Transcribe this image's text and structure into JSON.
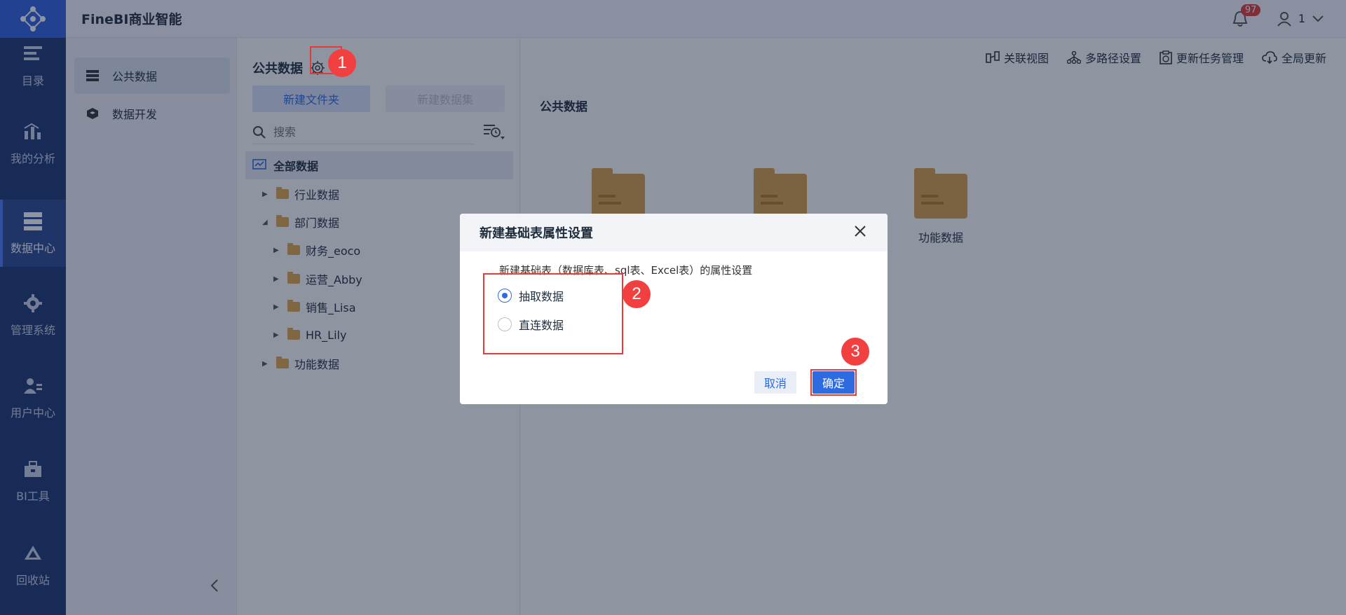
{
  "app": {
    "title": "FineBI商业智能"
  },
  "rail": {
    "items": [
      {
        "label": "目录",
        "icon": "catalog-icon"
      },
      {
        "label": "我的分析",
        "icon": "chart-icon"
      },
      {
        "label": "数据中心",
        "icon": "database-icon",
        "active": true
      },
      {
        "label": "管理系统",
        "icon": "gear-icon"
      },
      {
        "label": "用户中心",
        "icon": "user-icon"
      },
      {
        "label": "BI工具",
        "icon": "toolbox-icon"
      },
      {
        "label": "回收站",
        "icon": "recycle-icon"
      }
    ]
  },
  "topbar": {
    "notif_count": "97",
    "user": "1"
  },
  "nav2": {
    "items": [
      {
        "label": "公共数据",
        "active": true
      },
      {
        "label": "数据开发"
      }
    ]
  },
  "tree": {
    "title": "公共数据",
    "new_folder": "新建文件夹",
    "new_dataset": "新建数据集",
    "search_placeholder": "搜索",
    "root": "全部数据",
    "nodes": [
      {
        "label": "行业数据"
      },
      {
        "label": "部门数据"
      },
      {
        "label": "财务_eoco"
      },
      {
        "label": "运营_Abby"
      },
      {
        "label": "销售_Lisa"
      },
      {
        "label": "HR_Lily"
      },
      {
        "label": "功能数据"
      }
    ]
  },
  "main": {
    "toolbar": [
      "关联视图",
      "多路径设置",
      "更新任务管理",
      "全局更新"
    ],
    "title": "公共数据",
    "folders": [
      "",
      "",
      "功能数据"
    ]
  },
  "dialog": {
    "title": "新建基础表属性设置",
    "description": "新建基础表（数据库表、sql表、Excel表）的属性设置",
    "options": [
      "抽取数据",
      "直连数据"
    ],
    "selected": "抽取数据",
    "cancel": "取消",
    "confirm": "确定"
  },
  "steps": [
    "1",
    "2",
    "3"
  ],
  "colors": {
    "accent": "#2f6be0",
    "marker": "#f23f3f",
    "rail": "#1b3470"
  }
}
